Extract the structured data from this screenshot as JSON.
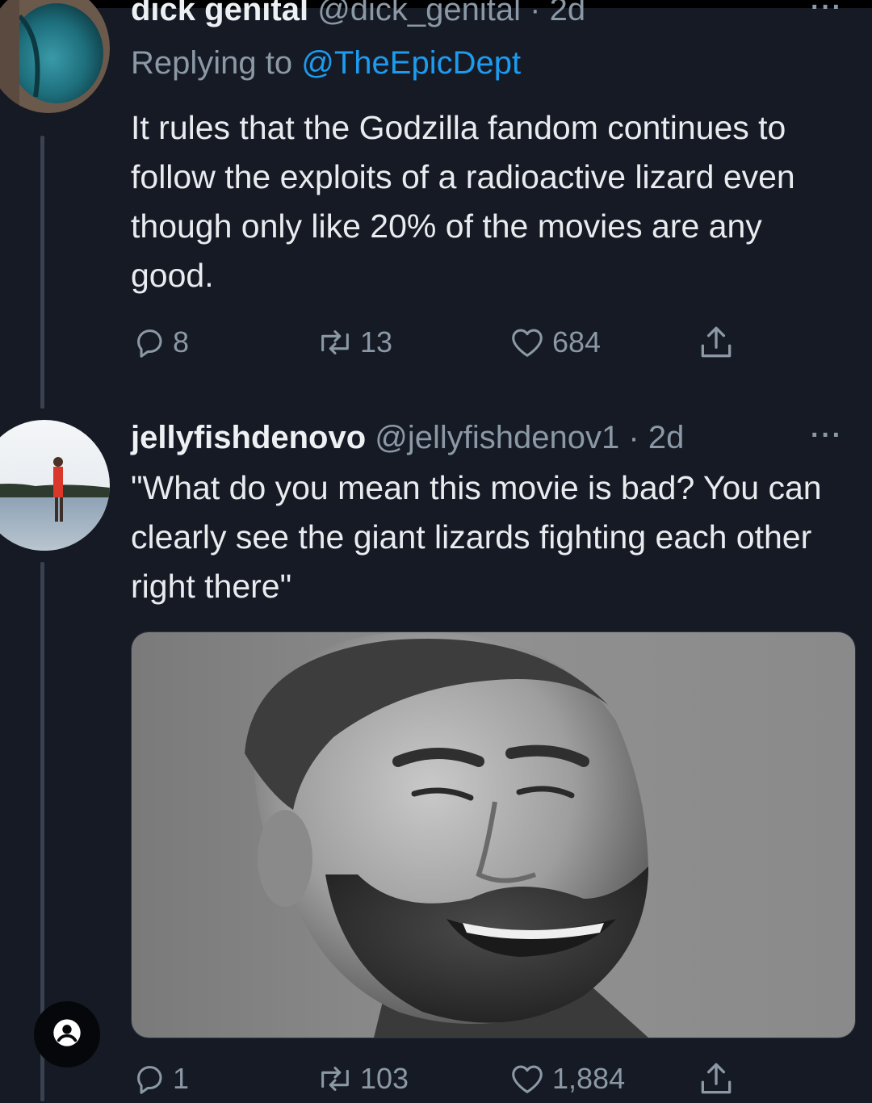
{
  "tweet1": {
    "display_name": "dick genital",
    "handle": "@dick_genital",
    "dot": "·",
    "time": "2d",
    "more": "···",
    "replying_prefix": "Replying to",
    "replying_to": "@TheEpicDept",
    "text": "It rules that the Godzilla fandom continues to follow the exploits of a radioactive lizard even though only like 20% of the movies are any good.",
    "replies": "8",
    "retweets": "13",
    "likes": "684"
  },
  "tweet2": {
    "display_name": "jellyfishdenovo",
    "handle": "@jellyfishdenov1",
    "dot": "·",
    "time": "2d",
    "more": "···",
    "text": "\"What do you mean this movie is bad? You can clearly see the giant lizards fighting each other right there\"",
    "replies": "1",
    "retweets": "103",
    "likes": "1,884"
  },
  "colors": {
    "background": "#151a24",
    "text": "#e9ecef",
    "muted": "#8b98a5",
    "link": "#1d9bf0"
  },
  "icons": {
    "reply": "reply-icon",
    "retweet": "retweet-icon",
    "like": "heart-icon",
    "share": "share-icon",
    "profile": "user-icon"
  }
}
